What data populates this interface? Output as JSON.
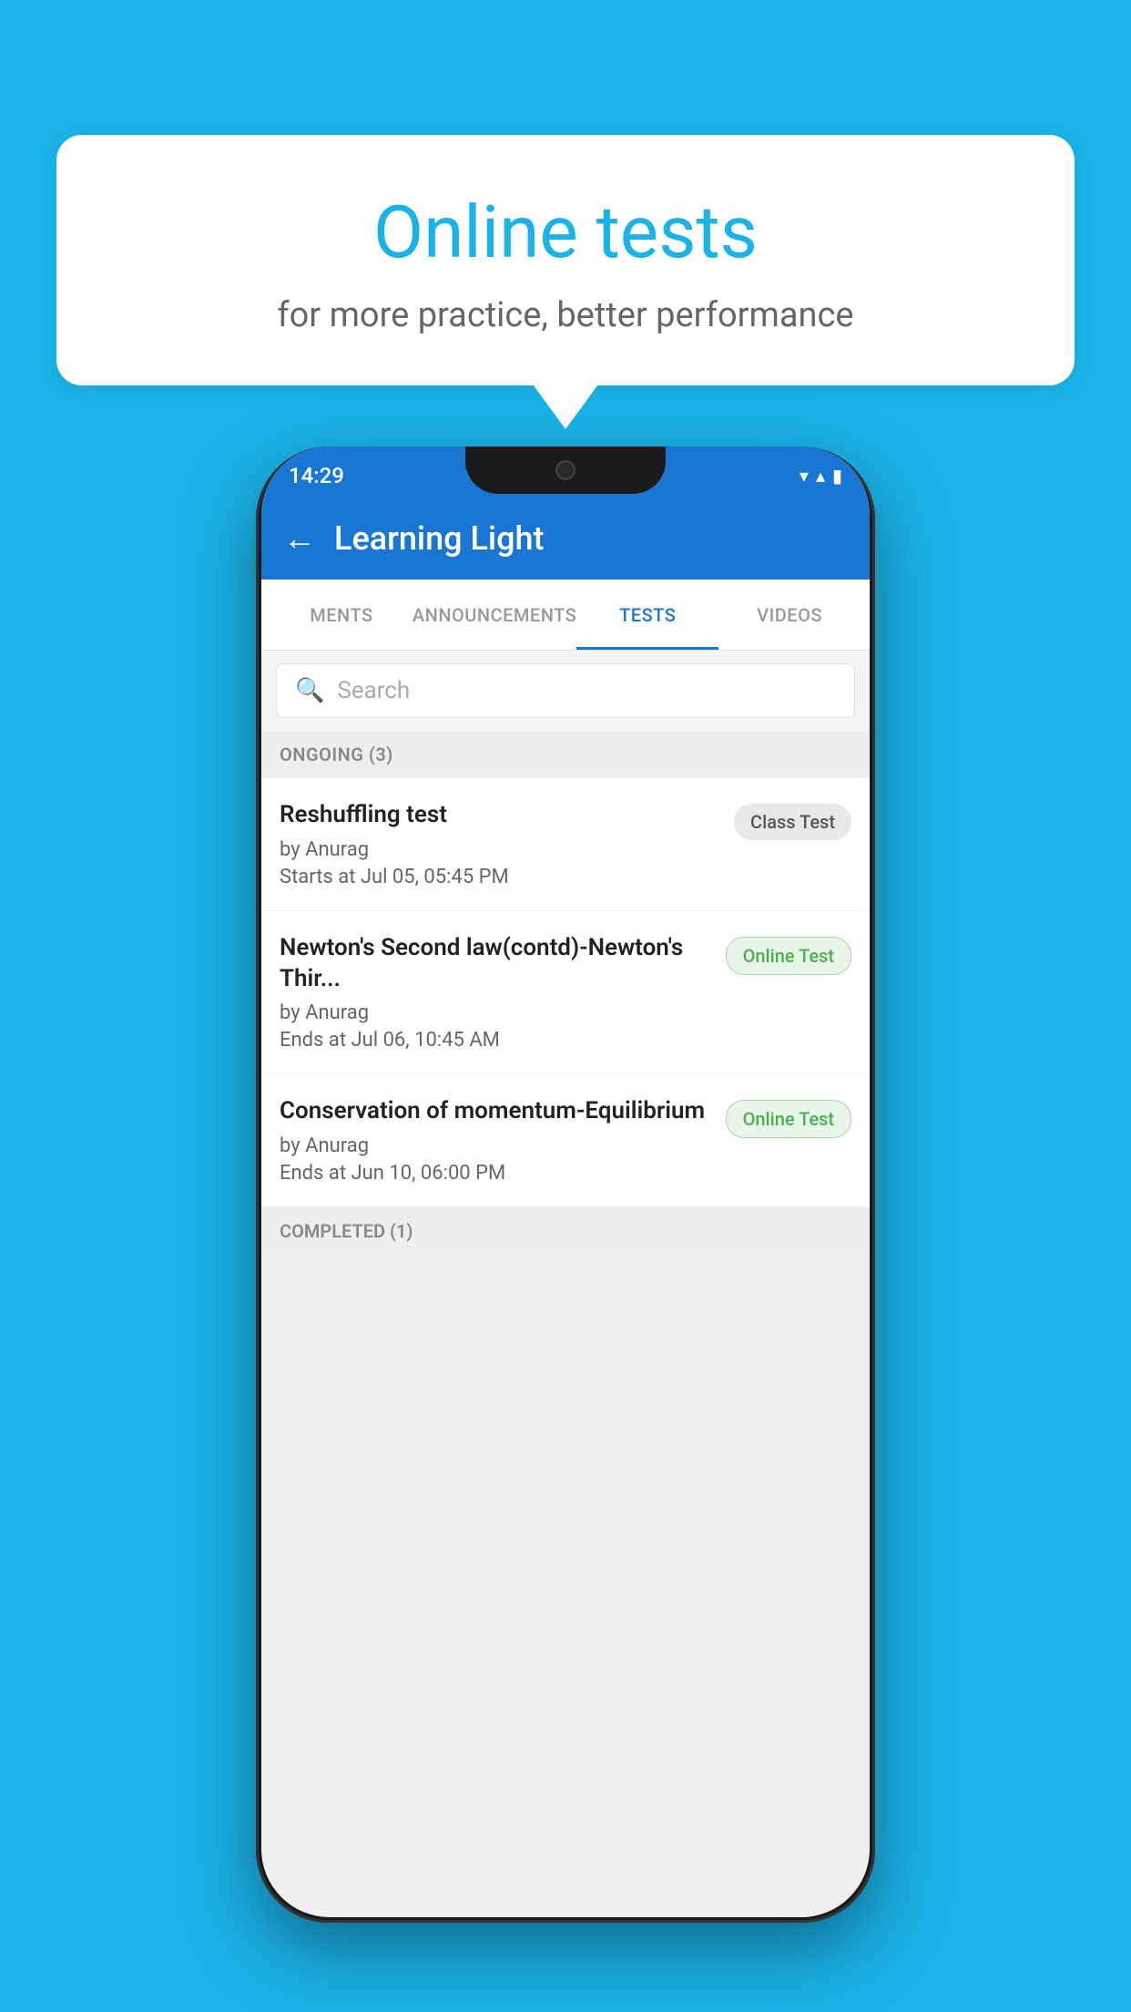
{
  "background": {
    "color": "#1ab3e8"
  },
  "speech_bubble": {
    "title": "Online tests",
    "subtitle": "for more practice, better performance"
  },
  "phone": {
    "status_bar": {
      "time": "14:29",
      "wifi": "▼",
      "signal": "▲",
      "battery": "▮"
    },
    "app_bar": {
      "back_label": "←",
      "title": "Learning Light"
    },
    "tabs": [
      {
        "label": "MENTS",
        "active": false
      },
      {
        "label": "ANNOUNCEMENTS",
        "active": false
      },
      {
        "label": "TESTS",
        "active": true
      },
      {
        "label": "VIDEOS",
        "active": false
      }
    ],
    "search": {
      "placeholder": "Search"
    },
    "ongoing_section": {
      "label": "ONGOING (3)"
    },
    "tests": [
      {
        "title": "Reshuffling test",
        "author": "by Anurag",
        "time_label": "Starts at  Jul 05, 05:45 PM",
        "badge": "Class Test",
        "badge_type": "class"
      },
      {
        "title": "Newton's Second law(contd)-Newton's Thir...",
        "author": "by Anurag",
        "time_label": "Ends at  Jul 06, 10:45 AM",
        "badge": "Online Test",
        "badge_type": "online"
      },
      {
        "title": "Conservation of momentum-Equilibrium",
        "author": "by Anurag",
        "time_label": "Ends at  Jun 10, 06:00 PM",
        "badge": "Online Test",
        "badge_type": "online"
      }
    ],
    "completed_section": {
      "label": "COMPLETED (1)"
    }
  }
}
